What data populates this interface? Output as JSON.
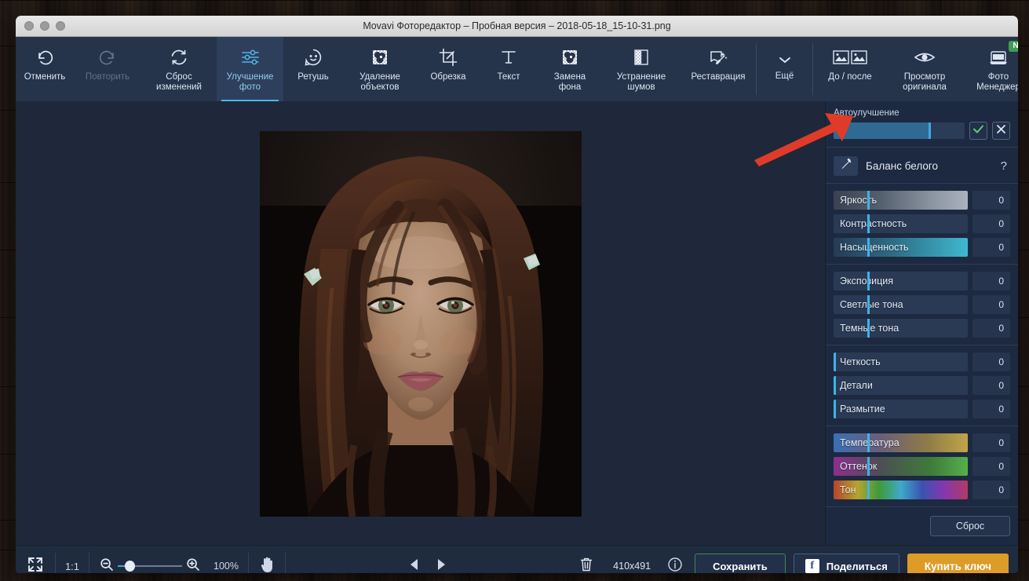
{
  "window": {
    "title": "Movavi Фоторедактор – Пробная версия – 2018-05-18_15-10-31.png"
  },
  "toolbar": {
    "items": [
      {
        "label": "Отменить",
        "icon": "undo-icon",
        "state": "enabled"
      },
      {
        "label": "Повторить",
        "icon": "redo-icon",
        "state": "disabled"
      },
      {
        "label": "Сброс\nизменений",
        "icon": "reset-changes-icon",
        "state": "enabled"
      },
      {
        "label": "Улучшение\nфото",
        "icon": "adjust-sliders-icon",
        "state": "active"
      },
      {
        "label": "Ретушь",
        "icon": "retouch-face-icon",
        "state": "enabled"
      },
      {
        "label": "Удаление\nобъектов",
        "icon": "object-removal-icon",
        "state": "enabled"
      },
      {
        "label": "Обрезка",
        "icon": "crop-icon",
        "state": "enabled"
      },
      {
        "label": "Текст",
        "icon": "text-icon",
        "state": "enabled"
      },
      {
        "label": "Замена\nфона",
        "icon": "background-swap-icon",
        "state": "enabled"
      },
      {
        "label": "Устранение\nшумов",
        "icon": "noise-removal-icon",
        "state": "enabled"
      },
      {
        "label": "Реставрация",
        "icon": "restoration-icon",
        "state": "enabled"
      },
      {
        "label": "Ещё",
        "icon": "chevron-down-icon",
        "state": "enabled"
      }
    ],
    "right_items": [
      {
        "label": "До / после",
        "icon": "before-after-icon"
      },
      {
        "label": "Просмотр\nоригинала",
        "icon": "eye-icon"
      },
      {
        "label": "Фото\nМенеджер",
        "icon": "photo-manager-icon",
        "badge": "New"
      }
    ]
  },
  "panel": {
    "auto_enhance": {
      "label": "Автоулучшение",
      "fill_percent": 73,
      "apply_icon": "checkmark-icon",
      "cancel_icon": "close-icon"
    },
    "white_balance": {
      "label": "Баланс белого",
      "icon": "eyedropper-icon",
      "help": "?"
    },
    "groups": [
      {
        "sliders": [
          {
            "label": "Яркость",
            "value": "0",
            "handle_percent": 25,
            "style": "g-brightness"
          },
          {
            "label": "Контрастность",
            "value": "0",
            "handle_percent": 25,
            "style": "g-plain"
          },
          {
            "label": "Насыщенность",
            "value": "0",
            "handle_percent": 25,
            "style": "g-saturation"
          }
        ]
      },
      {
        "sliders": [
          {
            "label": "Экспозиция",
            "value": "0",
            "handle_percent": 25,
            "style": "g-plain"
          },
          {
            "label": "Светлые тона",
            "value": "0",
            "handle_percent": 25,
            "style": "g-plain"
          },
          {
            "label": "Темные тона",
            "value": "0",
            "handle_percent": 25,
            "style": "g-plain"
          }
        ]
      },
      {
        "sliders": [
          {
            "label": "Четкость",
            "value": "0",
            "handle_percent": 0,
            "style": "g-plain"
          },
          {
            "label": "Детали",
            "value": "0",
            "handle_percent": 0,
            "style": "g-plain"
          },
          {
            "label": "Размытие",
            "value": "0",
            "handle_percent": 0,
            "style": "g-plain"
          }
        ]
      },
      {
        "sliders": [
          {
            "label": "Температура",
            "value": "0",
            "handle_percent": 25,
            "style": "g-temp"
          },
          {
            "label": "Оттенок",
            "value": "0",
            "handle_percent": 25,
            "style": "g-tint"
          },
          {
            "label": "Тон",
            "value": "0",
            "handle_percent": 25,
            "style": "g-hue"
          }
        ]
      }
    ],
    "reset_label": "Сброс"
  },
  "bottombar": {
    "fit_icon": "fit-to-screen-icon",
    "one_to_one": "1:1",
    "zoom_out_icon": "zoom-out-icon",
    "zoom_in_icon": "zoom-in-icon",
    "zoom_level": "100%",
    "hand_icon": "hand-tool-icon",
    "prev_icon": "previous-image-icon",
    "next_icon": "next-image-icon",
    "delete_icon": "trash-icon",
    "dimensions": "410x491",
    "info_icon": "info-icon",
    "save_label": "Сохранить",
    "share_label": "Поделиться",
    "share_icon": "facebook-icon",
    "buy_label": "Купить ключ"
  },
  "annotation": {
    "arrow_color": "#e03b28",
    "points_at": "auto-enhance-slider"
  },
  "colors": {
    "accent": "#4fb6e8",
    "toolbar_bg": "#25334b",
    "panel_bg": "#1d2940",
    "buy_button": "#dd9b28",
    "save_border": "#3f8a55",
    "badge_new": "#3f9d52"
  }
}
